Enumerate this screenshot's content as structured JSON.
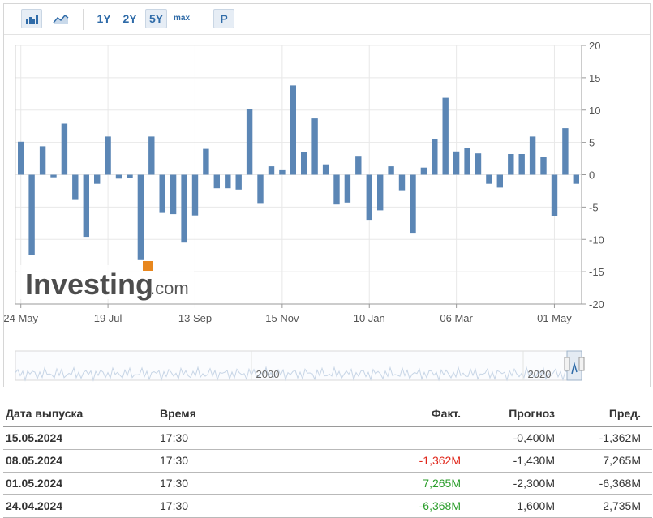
{
  "toolbar": {
    "range_buttons": [
      "1Y",
      "2Y",
      "5Y",
      "max"
    ],
    "active_range": "5Y",
    "p_button": "P",
    "icons": [
      "bar-chart-icon",
      "area-chart-icon"
    ]
  },
  "colors": {
    "bar": "#5b86b5",
    "grid": "#e8e8e8",
    "negative": "#e0271b",
    "positive": "#2a9d2a",
    "navigator": "#c7d5e6"
  },
  "watermark": {
    "brand": "Investing",
    "suffix": ".com"
  },
  "chart_data": {
    "type": "bar",
    "ylim": [
      -20,
      20
    ],
    "yticks": [
      20,
      15,
      10,
      5,
      0,
      -5,
      -10,
      -15,
      -20
    ],
    "y_axis_position": "right",
    "grid": true,
    "x_tick_labels": [
      "24 May",
      "19 Jul",
      "13 Sep",
      "15 Nov",
      "10 Jan",
      "06 Mar",
      "01 May"
    ],
    "values": [
      5.1,
      -12.4,
      4.4,
      -0.4,
      7.9,
      -3.9,
      -9.6,
      -1.4,
      5.9,
      -0.6,
      -0.5,
      -13.2,
      5.9,
      -5.9,
      -6.1,
      -10.5,
      -6.3,
      4.0,
      -2.1,
      -2.1,
      -2.3,
      10.1,
      -4.5,
      1.3,
      0.7,
      13.8,
      3.5,
      8.7,
      1.6,
      -4.6,
      -4.3,
      2.8,
      -7.1,
      -5.5,
      1.3,
      -2.4,
      -9.1,
      1.1,
      5.5,
      11.9,
      3.6,
      4.1,
      3.3,
      -1.4,
      -2.0,
      3.2,
      3.2,
      5.9,
      2.7,
      -6.4,
      7.2,
      -1.4
    ],
    "navigator": {
      "labels": [
        "2000",
        "2020"
      ]
    }
  },
  "table": {
    "headers": {
      "date": "Дата выпуска",
      "time": "Время",
      "actual": "Факт.",
      "forecast": "Прогноз",
      "previous": "Пред."
    },
    "rows": [
      {
        "date": "15.05.2024",
        "time": "17:30",
        "actual": "",
        "actual_sign": "",
        "forecast": "-0,400M",
        "previous": "-1,362M"
      },
      {
        "date": "08.05.2024",
        "time": "17:30",
        "actual": "-1,362M",
        "actual_sign": "neg",
        "forecast": "-1,430M",
        "previous": "7,265M"
      },
      {
        "date": "01.05.2024",
        "time": "17:30",
        "actual": "7,265M",
        "actual_sign": "pos",
        "forecast": "-2,300M",
        "previous": "-6,368M"
      },
      {
        "date": "24.04.2024",
        "time": "17:30",
        "actual": "-6,368M",
        "actual_sign": "pos",
        "forecast": "1,600M",
        "previous": "2,735M"
      }
    ]
  }
}
